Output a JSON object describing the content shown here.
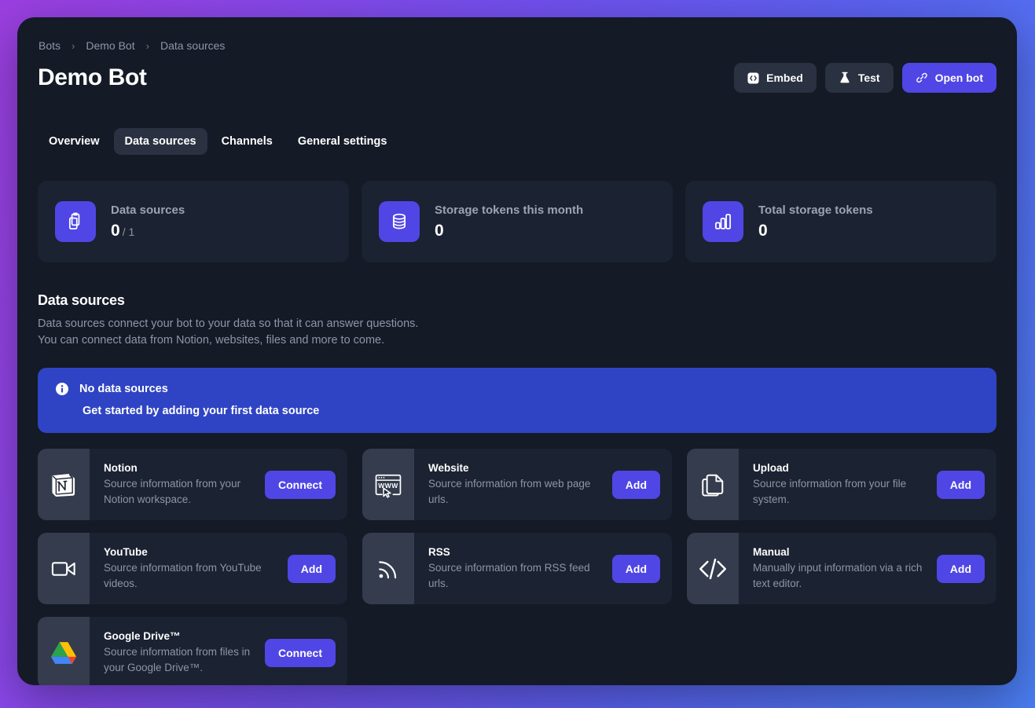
{
  "theme": {
    "panel_bg": "#141a26",
    "card_bg": "#1b2231",
    "accent": "#4f46e5",
    "alert_bg": "#2f44c4",
    "muted_text": "#8d96a8",
    "icon_panel_bg": "#343c4d",
    "bg_gradient_from": "#9b3fe0",
    "bg_gradient_to": "#4a7ef2"
  },
  "breadcrumb": {
    "items": [
      {
        "label": "Bots"
      },
      {
        "label": "Demo Bot"
      },
      {
        "label": "Data sources"
      }
    ],
    "separator": "›"
  },
  "header": {
    "title": "Demo Bot",
    "actions": [
      {
        "label": "Embed",
        "icon": "code-embed-icon",
        "style": "dark"
      },
      {
        "label": "Test",
        "icon": "flask-icon",
        "style": "dark"
      },
      {
        "label": "Open bot",
        "icon": "link-icon",
        "style": "primary"
      }
    ]
  },
  "tabs": [
    {
      "label": "Overview",
      "active": false
    },
    {
      "label": "Data sources",
      "active": true
    },
    {
      "label": "Channels",
      "active": false
    },
    {
      "label": "General settings",
      "active": false
    }
  ],
  "stats": [
    {
      "label": "Data sources",
      "value": "0",
      "sub": "/ 1",
      "icon": "copy-documents-icon"
    },
    {
      "label": "Storage tokens this month",
      "value": "0",
      "sub": "",
      "icon": "database-icon"
    },
    {
      "label": "Total storage tokens",
      "value": "0",
      "sub": "",
      "icon": "bar-chart-icon"
    }
  ],
  "section": {
    "title": "Data sources",
    "description": "Data sources connect your bot to your data so that it can answer questions. You can connect data from Notion, websites, files and more to come."
  },
  "alert": {
    "icon": "info-icon",
    "title": "No data sources",
    "body": "Get started by adding your first data source"
  },
  "sources": [
    {
      "name": "Notion",
      "description": "Source information from your Notion workspace.",
      "action": "Connect",
      "icon": "notion-icon"
    },
    {
      "name": "Website",
      "description": "Source information from web page urls.",
      "action": "Add",
      "icon": "browser-www-icon"
    },
    {
      "name": "Upload",
      "description": "Source information from your file system.",
      "action": "Add",
      "icon": "file-upload-icon"
    },
    {
      "name": "YouTube",
      "description": "Source information from YouTube videos.",
      "action": "Add",
      "icon": "video-camera-icon"
    },
    {
      "name": "RSS",
      "description": "Source information from RSS feed urls.",
      "action": "Add",
      "icon": "rss-icon"
    },
    {
      "name": "Manual",
      "description": "Manually input information via a rich text editor.",
      "action": "Add",
      "icon": "code-brackets-icon"
    },
    {
      "name": "Google Drive™",
      "description": "Source information from files in your Google Drive™.",
      "action": "Connect",
      "icon": "google-drive-icon"
    }
  ]
}
